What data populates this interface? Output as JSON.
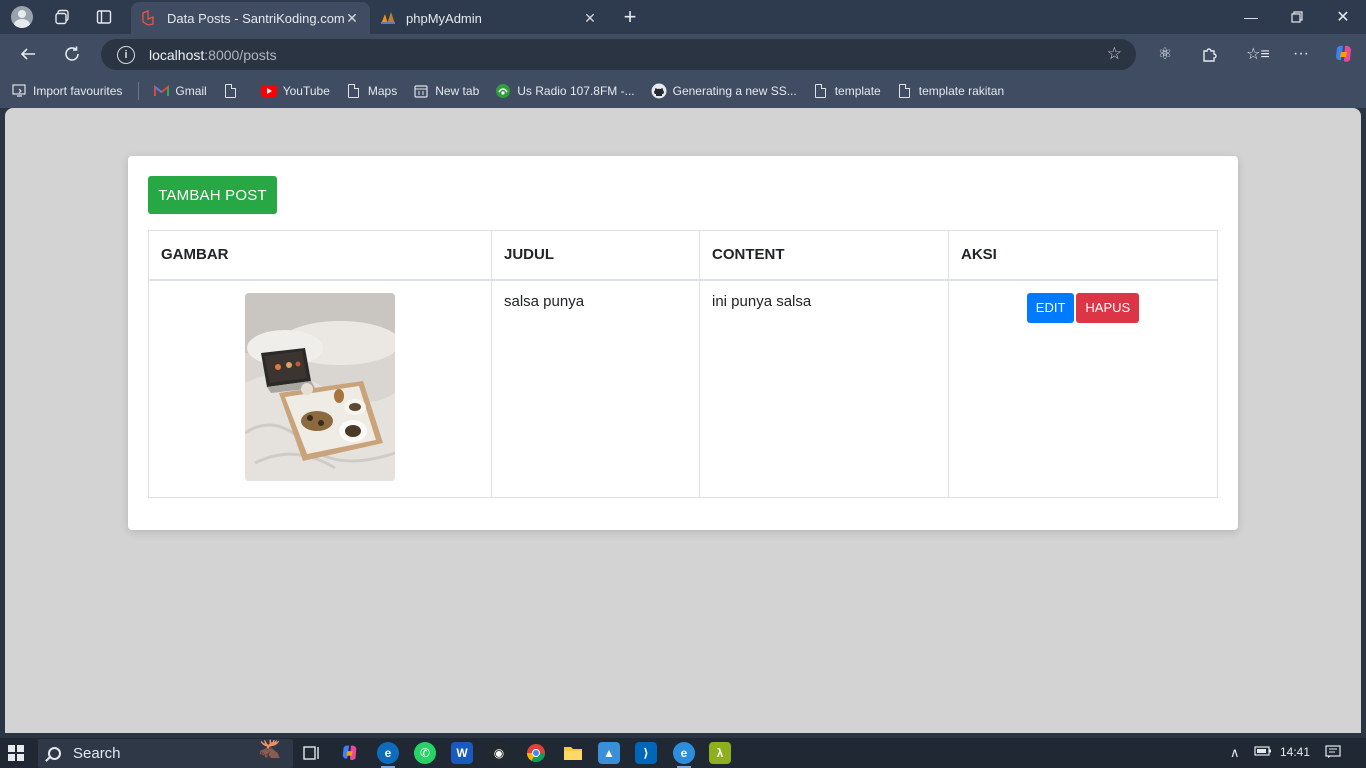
{
  "browser": {
    "tabs": [
      {
        "title": "Data Posts - SantriKoding.com",
        "active": true
      },
      {
        "title": "phpMyAdmin",
        "active": false
      }
    ],
    "url_host": "localhost",
    "url_path": ":8000/posts",
    "bookmarks": [
      {
        "label": "Import favourites",
        "icon": "import-icon"
      },
      {
        "label": "Gmail",
        "icon": "gmail-icon"
      },
      {
        "label": "",
        "icon": "page-icon"
      },
      {
        "label": "YouTube",
        "icon": "youtube-icon"
      },
      {
        "label": "Maps",
        "icon": "page-icon"
      },
      {
        "label": "New tab",
        "icon": "newtab-icon"
      },
      {
        "label": "Us Radio 107.8FM -...",
        "icon": "radio-icon"
      },
      {
        "label": "Generating a new SS...",
        "icon": "github-icon"
      },
      {
        "label": "template",
        "icon": "page-icon"
      },
      {
        "label": "template rakitan",
        "icon": "page-icon"
      }
    ]
  },
  "page": {
    "add_button": "TAMBAH POST",
    "columns": [
      "GAMBAR",
      "JUDUL",
      "CONTENT",
      "AKSI"
    ],
    "rows": [
      {
        "judul": "salsa punya",
        "content": "ini punya salsa",
        "edit": "EDIT",
        "delete": "HAPUS"
      }
    ]
  },
  "taskbar": {
    "search_label": "Search",
    "time": "14:41"
  },
  "colors": {
    "primary": "#007bff",
    "success": "#28a745",
    "danger": "#dc3545",
    "page_bg": "#d3d3d3",
    "chrome": "#3f4c61"
  }
}
